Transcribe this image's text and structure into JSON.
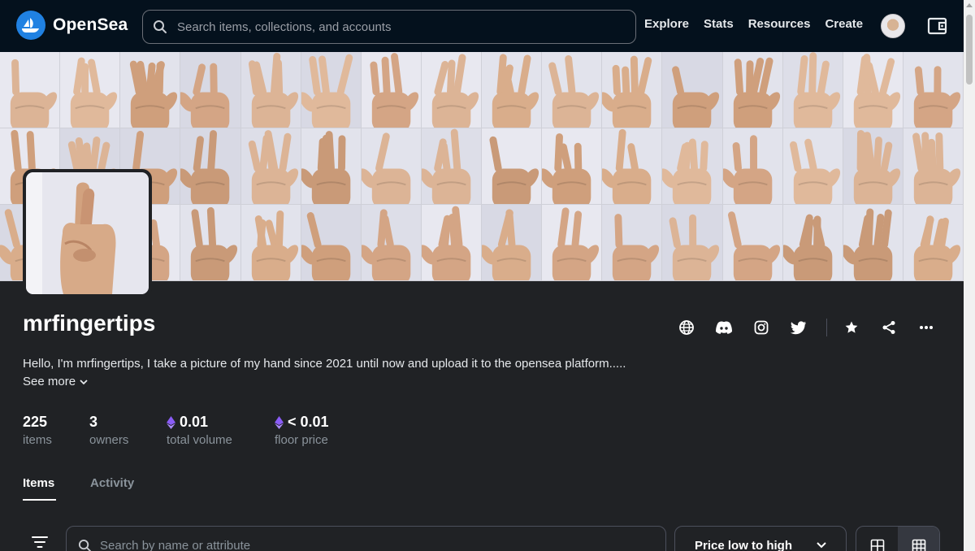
{
  "nav": {
    "logo_text": "OpenSea",
    "search_placeholder": "Search items, collections, and accounts",
    "links": [
      {
        "label": "Explore"
      },
      {
        "label": "Stats"
      },
      {
        "label": "Resources"
      },
      {
        "label": "Create"
      }
    ]
  },
  "collection": {
    "name": "mrfingertips",
    "description": "Hello, I'm mrfingertips, I take a picture of my hand since 2021 until now and upload it to the opensea platform.....",
    "see_more": "See more",
    "social_icons": [
      "globe-icon",
      "discord-icon",
      "instagram-icon",
      "twitter-icon",
      "star-icon",
      "share-icon",
      "more-icon"
    ]
  },
  "stats": [
    {
      "value": "225",
      "label": "items"
    },
    {
      "value": "3",
      "label": "owners"
    },
    {
      "value": "0.01",
      "label": "total volume"
    },
    {
      "value": "< 0.01",
      "label": "floor price"
    }
  ],
  "tabs": [
    {
      "label": "Items",
      "active": true
    },
    {
      "label": "Activity",
      "active": false
    }
  ],
  "filter_bar": {
    "search_placeholder": "Search by name or attribute",
    "sort_label": "Price low to high",
    "view_modes": [
      "large-grid-icon",
      "small-grid-icon"
    ],
    "active_view": "small-grid-icon"
  },
  "colors": {
    "nav_bg": "#04111d",
    "page_bg": "#202225",
    "brand_blue": "#2081e2",
    "eth_purple": "#8a5cf6",
    "muted_text": "#8a939b"
  }
}
